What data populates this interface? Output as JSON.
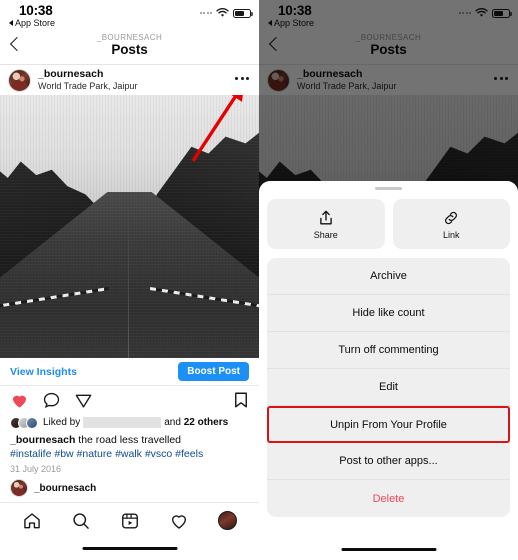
{
  "status_bar": {
    "time": "10:38",
    "back_app": "App Store",
    "wifi_icon": "wifi-icon",
    "battery_icon": "battery-icon",
    "battery_level": 60,
    "signal_icon": "signal-dots-icon"
  },
  "nav": {
    "back_icon": "chevron-left-icon",
    "subtitle": "_BOURNESACH",
    "title": "Posts"
  },
  "post": {
    "avatar": "user-avatar",
    "username": "_bournesach",
    "location": "World Trade Park, Jaipur",
    "more_icon": "more-options-icon",
    "photo_alt": "black and white photo of tree-lined road",
    "annotation_arrow": "red-arrow-annotation"
  },
  "insights": {
    "view_insights_label": "View Insights",
    "boost_label": "Boost Post",
    "link_color": "#1d8ef0",
    "boost_bg": "#1d90f5"
  },
  "actions": {
    "like_icon": "heart-filled-icon",
    "like_color": "#ed4956",
    "comment_icon": "comment-icon",
    "share_icon": "send-icon",
    "save_icon": "bookmark-icon"
  },
  "likes": {
    "prefix": "Liked by",
    "redacted_user": "",
    "middle": "and",
    "count_text": "22 others"
  },
  "caption": {
    "username": "_bournesach",
    "text": "the road less travelled",
    "hashtags": "#instalife #bw #nature #walk #vsco #feels",
    "date": "31 July 2016"
  },
  "comment": {
    "username": "_bournesach"
  },
  "tabbar": {
    "items": [
      {
        "icon": "home-icon",
        "name": "tab-home"
      },
      {
        "icon": "search-icon",
        "name": "tab-search"
      },
      {
        "icon": "reels-icon",
        "name": "tab-reels"
      },
      {
        "icon": "heart-icon",
        "name": "tab-activity"
      },
      {
        "icon": "profile-avatar-icon",
        "name": "tab-profile"
      }
    ]
  },
  "sheet": {
    "grabber": "drag-handle",
    "quick_actions": [
      {
        "label": "Share",
        "icon": "share-up-icon"
      },
      {
        "label": "Link",
        "icon": "link-icon"
      }
    ],
    "menu_items": [
      {
        "label": "Archive",
        "style": "normal"
      },
      {
        "label": "Hide like count",
        "style": "normal"
      },
      {
        "label": "Turn off commenting",
        "style": "normal"
      },
      {
        "label": "Edit",
        "style": "normal"
      },
      {
        "label": "Unpin From Your Profile",
        "style": "highlight"
      },
      {
        "label": "Post to other apps...",
        "style": "normal"
      },
      {
        "label": "Delete",
        "style": "danger"
      }
    ],
    "highlight_color": "#d81414",
    "danger_color": "#ed4956"
  }
}
